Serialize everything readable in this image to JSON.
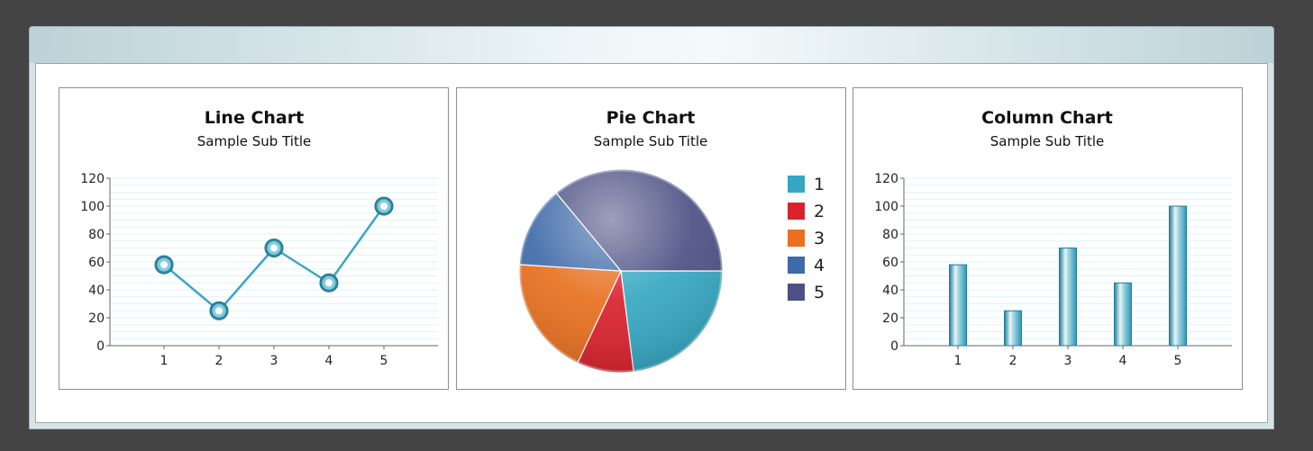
{
  "chart_data": [
    {
      "type": "line",
      "title": "Line Chart",
      "subtitle": "Sample Sub Title",
      "categories": [
        "1",
        "2",
        "3",
        "4",
        "5"
      ],
      "values": [
        58,
        25,
        70,
        45,
        100
      ],
      "ylim": [
        0,
        120
      ],
      "yticks": [
        "0",
        "20",
        "40",
        "60",
        "80",
        "100",
        "120"
      ],
      "grid": true,
      "color": "#3aa7c2"
    },
    {
      "type": "pie",
      "title": "Pie Chart",
      "subtitle": "Sample Sub Title",
      "labels": [
        "1",
        "2",
        "3",
        "4",
        "5"
      ],
      "values": [
        23,
        9,
        19,
        13,
        36
      ],
      "colors": [
        "#35a7c2",
        "#d9222e",
        "#e8701f",
        "#3f6aa8",
        "#4c5083"
      ],
      "legend_position": "right"
    },
    {
      "type": "bar",
      "title": "Column Chart",
      "subtitle": "Sample Sub Title",
      "categories": [
        "1",
        "2",
        "3",
        "4",
        "5"
      ],
      "values": [
        58,
        25,
        70,
        45,
        100
      ],
      "ylim": [
        0,
        120
      ],
      "yticks": [
        "0",
        "20",
        "40",
        "60",
        "80",
        "100",
        "120"
      ],
      "grid": true,
      "color": "#2a98b6"
    }
  ]
}
